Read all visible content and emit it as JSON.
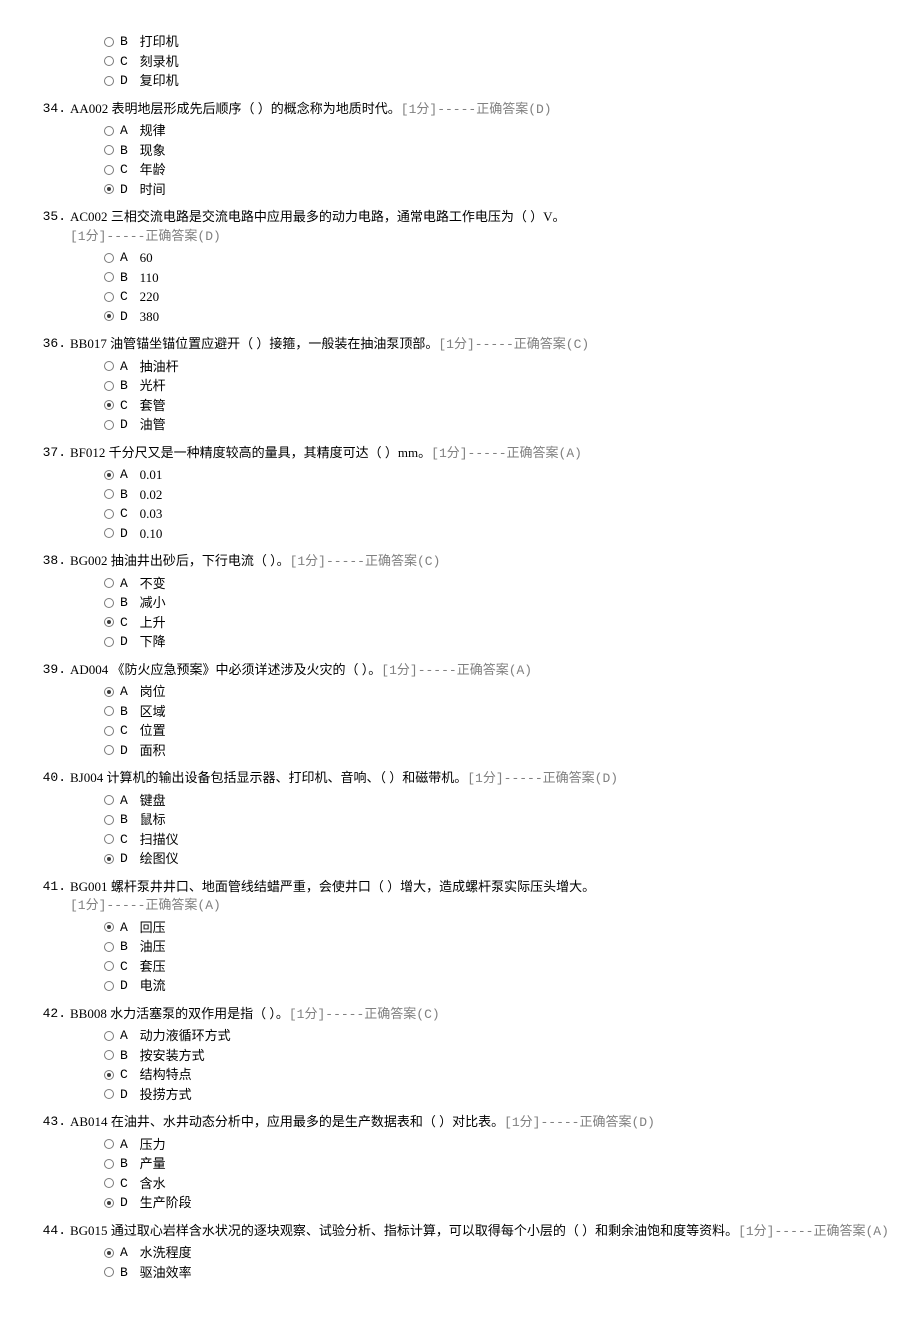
{
  "score_label": "[1分]",
  "answer_prefix": "-----正确答案",
  "questions": [
    {
      "num": "",
      "stem_pre": "",
      "stem_post": "",
      "meta_inline": true,
      "answer": "",
      "selected": "",
      "no_header": true,
      "choices": [
        {
          "k": "B",
          "t": "打印机"
        },
        {
          "k": "C",
          "t": "刻录机"
        },
        {
          "k": "D",
          "t": "复印机"
        }
      ]
    },
    {
      "num": "34.",
      "code": "AA002",
      "stem_pre": "  表明地层形成先后顺序（    ）的概念称为地质时代。",
      "meta_inline": true,
      "answer": "(D)",
      "selected": "D",
      "choices": [
        {
          "k": "A",
          "t": "规律"
        },
        {
          "k": "B",
          "t": "现象"
        },
        {
          "k": "C",
          "t": "年龄"
        },
        {
          "k": "D",
          "t": "时间"
        }
      ]
    },
    {
      "num": "35.",
      "code": "AC002",
      "stem_pre": "  三相交流电路是交流电路中应用最多的动力电路，通常电路工作电压为（    ）V。",
      "meta_inline": false,
      "answer": "(D)",
      "selected": "D",
      "choices": [
        {
          "k": "A",
          "t": "60"
        },
        {
          "k": "B",
          "t": "110"
        },
        {
          "k": "C",
          "t": "220"
        },
        {
          "k": "D",
          "t": "380"
        }
      ]
    },
    {
      "num": "36.",
      "code": "BB017",
      "stem_pre": "  油管锚坐锚位置应避开（    ）接箍，一般装在抽油泵顶部。",
      "meta_inline": true,
      "answer": "(C)",
      "selected": "C",
      "choices": [
        {
          "k": "A",
          "t": "抽油杆"
        },
        {
          "k": "B",
          "t": "光杆"
        },
        {
          "k": "C",
          "t": "套管"
        },
        {
          "k": "D",
          "t": "油管"
        }
      ]
    },
    {
      "num": "37.",
      "code": "BF012",
      "stem_pre": "  千分尺又是一种精度较高的量具，其精度可达（    ）mm。",
      "meta_inline": true,
      "answer": "(A)",
      "selected": "A",
      "choices": [
        {
          "k": "A",
          "t": "0.01"
        },
        {
          "k": "B",
          "t": "0.02"
        },
        {
          "k": "C",
          "t": "0.03"
        },
        {
          "k": "D",
          "t": "0.10"
        }
      ]
    },
    {
      "num": "38.",
      "code": "BG002",
      "stem_pre": "  抽油井出砂后，下行电流（    ）。",
      "meta_inline": true,
      "answer": "(C)",
      "selected": "C",
      "choices": [
        {
          "k": "A",
          "t": "不变"
        },
        {
          "k": "B",
          "t": "减小"
        },
        {
          "k": "C",
          "t": "上升"
        },
        {
          "k": "D",
          "t": "下降"
        }
      ]
    },
    {
      "num": "39.",
      "code": "AD004",
      "stem_pre": "  《防火应急预案》中必须详述涉及火灾的（    ）。",
      "meta_inline": true,
      "answer": "(A)",
      "selected": "A",
      "choices": [
        {
          "k": "A",
          "t": "岗位"
        },
        {
          "k": "B",
          "t": "区域"
        },
        {
          "k": "C",
          "t": "位置"
        },
        {
          "k": "D",
          "t": "面积"
        }
      ]
    },
    {
      "num": "40.",
      "code": "BJ004",
      "stem_pre": "  计算机的输出设备包括显示器、打印机、音响、（    ）和磁带机。",
      "meta_inline": true,
      "answer": "(D)",
      "selected": "D",
      "choices": [
        {
          "k": "A",
          "t": "键盘"
        },
        {
          "k": "B",
          "t": "鼠标"
        },
        {
          "k": "C",
          "t": "扫描仪"
        },
        {
          "k": "D",
          "t": "绘图仪"
        }
      ]
    },
    {
      "num": "41.",
      "code": "BG001",
      "stem_pre": "  螺杆泵井井口、地面管线结蜡严重，会使井口（    ）增大，造成螺杆泵实际压头增大。",
      "meta_inline": false,
      "answer": "(A)",
      "selected": "A",
      "choices": [
        {
          "k": "A",
          "t": "回压"
        },
        {
          "k": "B",
          "t": "油压"
        },
        {
          "k": "C",
          "t": "套压"
        },
        {
          "k": "D",
          "t": "电流"
        }
      ]
    },
    {
      "num": "42.",
      "code": "BB008",
      "stem_pre": "  水力活塞泵的双作用是指（    ）。",
      "meta_inline": true,
      "answer": "(C)",
      "selected": "C",
      "choices": [
        {
          "k": "A",
          "t": "动力液循环方式"
        },
        {
          "k": "B",
          "t": "按安装方式"
        },
        {
          "k": "C",
          "t": "结构特点"
        },
        {
          "k": "D",
          "t": "投捞方式"
        }
      ]
    },
    {
      "num": "43.",
      "code": "AB014",
      "stem_pre": "  在油井、水井动态分析中，应用最多的是生产数据表和（    ）对比表。",
      "meta_inline": true,
      "answer": "(D)",
      "selected": "D",
      "choices": [
        {
          "k": "A",
          "t": "压力"
        },
        {
          "k": "B",
          "t": "产量"
        },
        {
          "k": "C",
          "t": "含水"
        },
        {
          "k": "D",
          "t": "生产阶段"
        }
      ]
    },
    {
      "num": "44.",
      "code": "BG015",
      "stem_pre": "  通过取心岩样含水状况的逐块观察、试验分析、指标计算，可以取得每个小层的（    ）和剩余油饱和度等资料。",
      "meta_inline": true,
      "wrap_meta": true,
      "answer": "(A)",
      "selected": "A",
      "choices": [
        {
          "k": "A",
          "t": "水洗程度"
        },
        {
          "k": "B",
          "t": "驱油效率"
        }
      ]
    }
  ]
}
